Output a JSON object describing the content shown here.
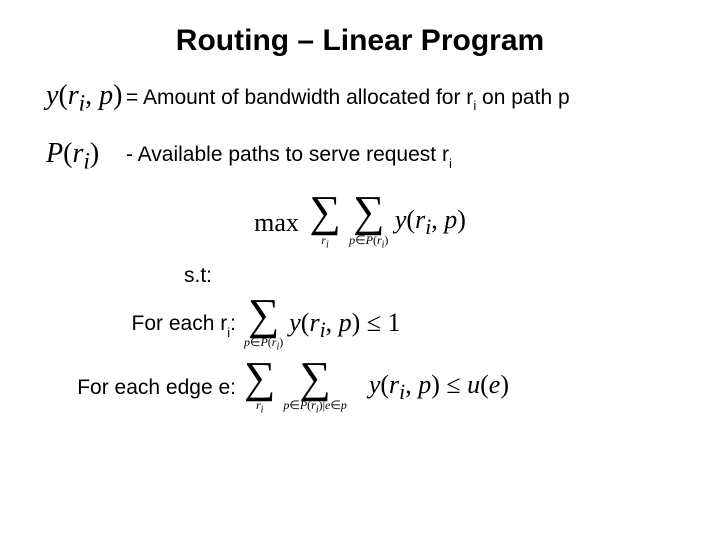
{
  "title": "Routing – Linear Program",
  "defs": {
    "y_symbol_html": "<span class='mi'>y</span>(<span class='mi'>r<sub>i</sub></span>, <span class='mi'>p</span>)",
    "y_desc_html": "= Amount of bandwidth allocated for r<span class='sub'>i</span> on path p",
    "p_symbol_html": "<span class='mi'>P</span>(<span class='mi'>r<sub>i</sub></span>)",
    "p_desc_html": "- Available paths to serve request r<span class='sub'>i</span>"
  },
  "objective": {
    "max": "max",
    "sum1_under_html": "<span class='mi'>r</span><sub><span class='mi'>i</span></sub>",
    "sum2_under_html": "<span class='mi'>p</span>&#8712;<span class='mi'>P</span>(<span class='mi'>r</span><sub><span class='mi'>i</span></sub>)",
    "term_html": "<span class='mi'>y</span>(<span class='mi'>r<sub>i</sub></span>, <span class='mi'>p</span>)"
  },
  "st": "s.t:",
  "c1": {
    "label_html": "For each r<span class='sub'>i</span>:",
    "sum_under_html": "<span class='mi'>p</span>&#8712;<span class='mi'>P</span>(<span class='mi'>r</span><sub><span class='mi'>i</span></sub>)",
    "expr_html": "<span class='mi'>y</span>(<span class='mi'>r<sub>i</sub></span>, <span class='mi'>p</span>) &le; 1"
  },
  "c2": {
    "label": "For each edge e:",
    "sum1_under_html": "<span class='mi'>r</span><sub><span class='mi'>i</span></sub>",
    "sum2_under_html": "<span class='mi'>p</span>&#8712;<span class='mi'>P</span>(<span class='mi'>r</span><sub><span class='mi'>i</span></sub>)|<span class='mi'>e</span>&#8712;<span class='mi'>p</span>",
    "expr_html": "<span class='mi'>y</span>(<span class='mi'>r<sub>i</sub></span>, <span class='mi'>p</span>) &le; <span class='mi'>u</span>(<span class='mi'>e</span>)"
  }
}
